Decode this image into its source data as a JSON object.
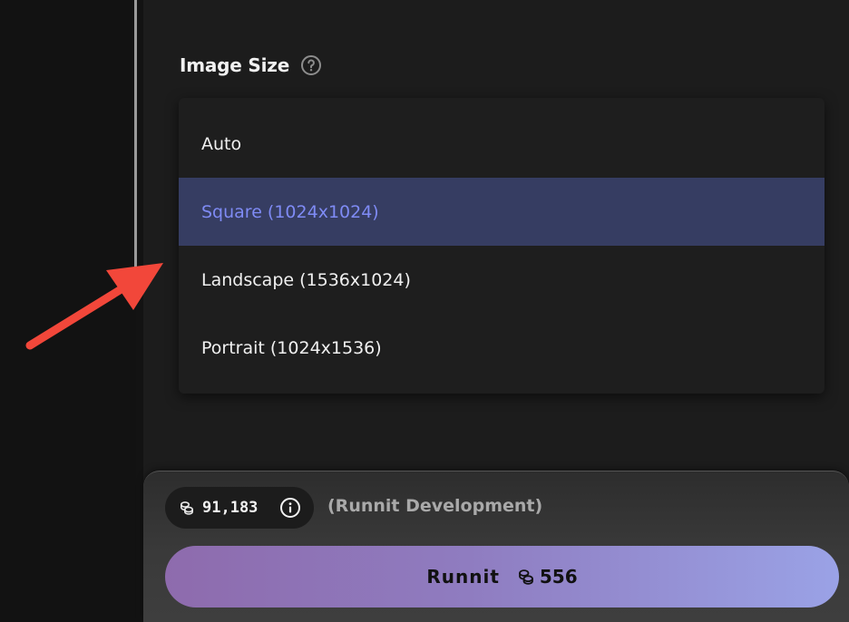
{
  "settings": {
    "image_size": {
      "label": "Image Size",
      "help_icon": "question-circle-icon",
      "options": [
        {
          "label": "Auto",
          "selected": false
        },
        {
          "label": "Square (1024x1024)",
          "selected": true
        },
        {
          "label": "Landscape (1536x1024)",
          "selected": false
        },
        {
          "label": "Portrait (1024x1536)",
          "selected": false
        }
      ]
    }
  },
  "footer": {
    "credits": {
      "amount": "91,183",
      "coin_icon": "coins-icon",
      "info_icon": "info-icon"
    },
    "workspace": "(Runnit Development)",
    "run_button": {
      "label": "Runnit",
      "cost": "556",
      "coin_icon": "coins-icon"
    }
  },
  "colors": {
    "selected_bg": "#363d62",
    "selected_text": "#7f8bf5",
    "annotation_arrow": "#f2473a",
    "button_gradient_start": "#8e6bad",
    "button_gradient_end": "#9aa2e6"
  }
}
